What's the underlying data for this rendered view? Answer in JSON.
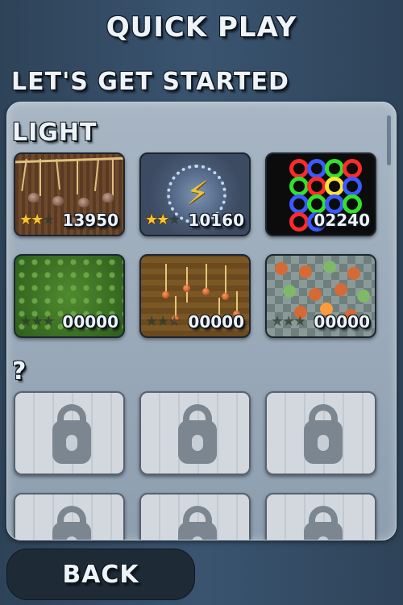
{
  "header": {
    "title": "QUICK PLAY",
    "subtitle": "LET'S GET STARTED"
  },
  "sections": {
    "light": "LIGHT",
    "locked": "?"
  },
  "levels": [
    {
      "score": "13950",
      "stars": 2,
      "icon": "rope-bombs"
    },
    {
      "score": "10160",
      "stars": 2,
      "icon": "lightning-bolt"
    },
    {
      "score": "02240",
      "stars": 0,
      "icon": "color-circles"
    },
    {
      "score": "00000",
      "stars": 0,
      "icon": "green-grid"
    },
    {
      "score": "00000",
      "stars": 0,
      "icon": "wood-beads"
    },
    {
      "score": "00000",
      "stars": 0,
      "icon": "checker-balls"
    }
  ],
  "locked_levels": [
    {
      "icon": "padlock-icon"
    },
    {
      "icon": "padlock-icon"
    },
    {
      "icon": "padlock-icon"
    },
    {
      "icon": "padlock-icon"
    },
    {
      "icon": "padlock-icon"
    },
    {
      "icon": "padlock-icon"
    }
  ],
  "footer": {
    "back_label": "BACK"
  },
  "colors": {
    "background": "#3a5470",
    "panel": "#9aabbb",
    "star": "#f7c436"
  }
}
